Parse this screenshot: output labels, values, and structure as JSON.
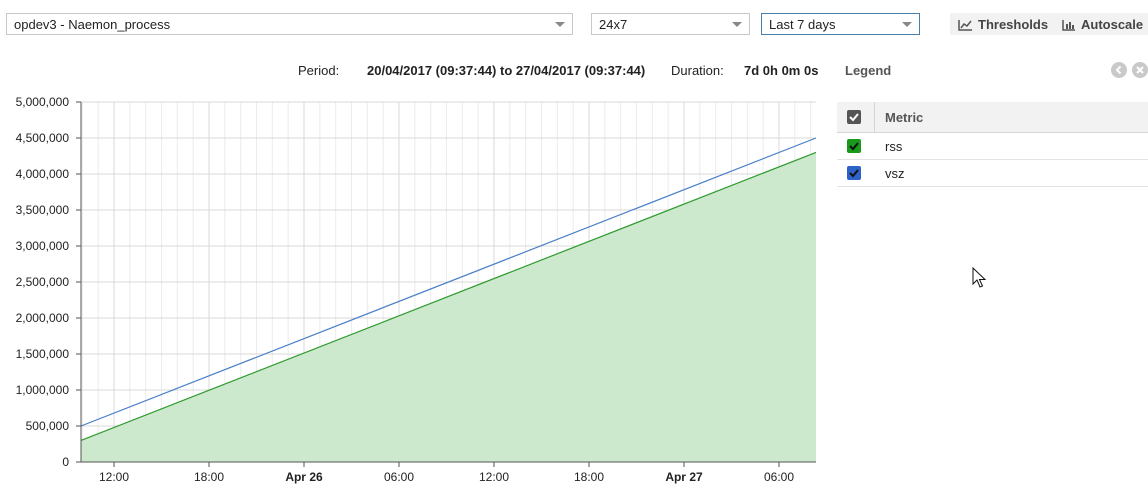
{
  "toolbar": {
    "host_service": "opdev3 - Naemon_process",
    "timeperiod": "24x7",
    "range": "Last 7 days",
    "thresholds_label": "Thresholds",
    "autoscale_label": "Autoscale"
  },
  "period": {
    "period_label": "Period:",
    "period_value": "20/04/2017 (09:37:44) to 27/04/2017 (09:37:44)",
    "duration_label": "Duration:",
    "duration_value": "7d 0h 0m 0s"
  },
  "legend": {
    "title": "Legend",
    "column_header": "Metric",
    "items": [
      {
        "label": "rss",
        "color": "#1a9a1a"
      },
      {
        "label": "vsz",
        "color": "#2f62c8"
      }
    ]
  },
  "chart_data": {
    "type": "line",
    "title": "",
    "xlabel": "",
    "ylabel": "",
    "x_ticks": [
      "12:00",
      "18:00",
      "Apr 26",
      "06:00",
      "12:00",
      "18:00",
      "Apr 27",
      "06:00"
    ],
    "x_ticks_bold": [
      false,
      false,
      true,
      false,
      false,
      false,
      true,
      false
    ],
    "y_ticks": [
      "0",
      "500,000",
      "1,000,000",
      "1,500,000",
      "2,000,000",
      "2,500,000",
      "3,000,000",
      "3,500,000",
      "4,000,000",
      "4,500,000",
      "5,000,000"
    ],
    "ylim": [
      0,
      5000000
    ],
    "x": [
      "Apr 25 09:37",
      "Apr 27 09:37"
    ],
    "series": [
      {
        "name": "rss",
        "values": [
          300000,
          4300000
        ],
        "color": "#2e9a2e",
        "fill": "#cde9cd",
        "area": true
      },
      {
        "name": "vsz",
        "values": [
          500000,
          4500000
        ],
        "color": "#4a7fc8",
        "area": false
      }
    ],
    "grid": true
  }
}
